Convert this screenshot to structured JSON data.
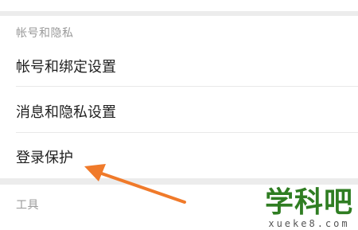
{
  "sections": [
    {
      "header": "帐号和隐私",
      "items": [
        {
          "label": "帐号和绑定设置"
        },
        {
          "label": "消息和隐私设置"
        },
        {
          "label": "登录保护"
        }
      ]
    },
    {
      "header": "工具"
    }
  ],
  "annotation": {
    "arrow_color": "#f07a2a",
    "points_to": "登录保护"
  },
  "watermark": {
    "logo": "学科吧",
    "url": "xueke8.com",
    "color": "#2f7d22"
  }
}
